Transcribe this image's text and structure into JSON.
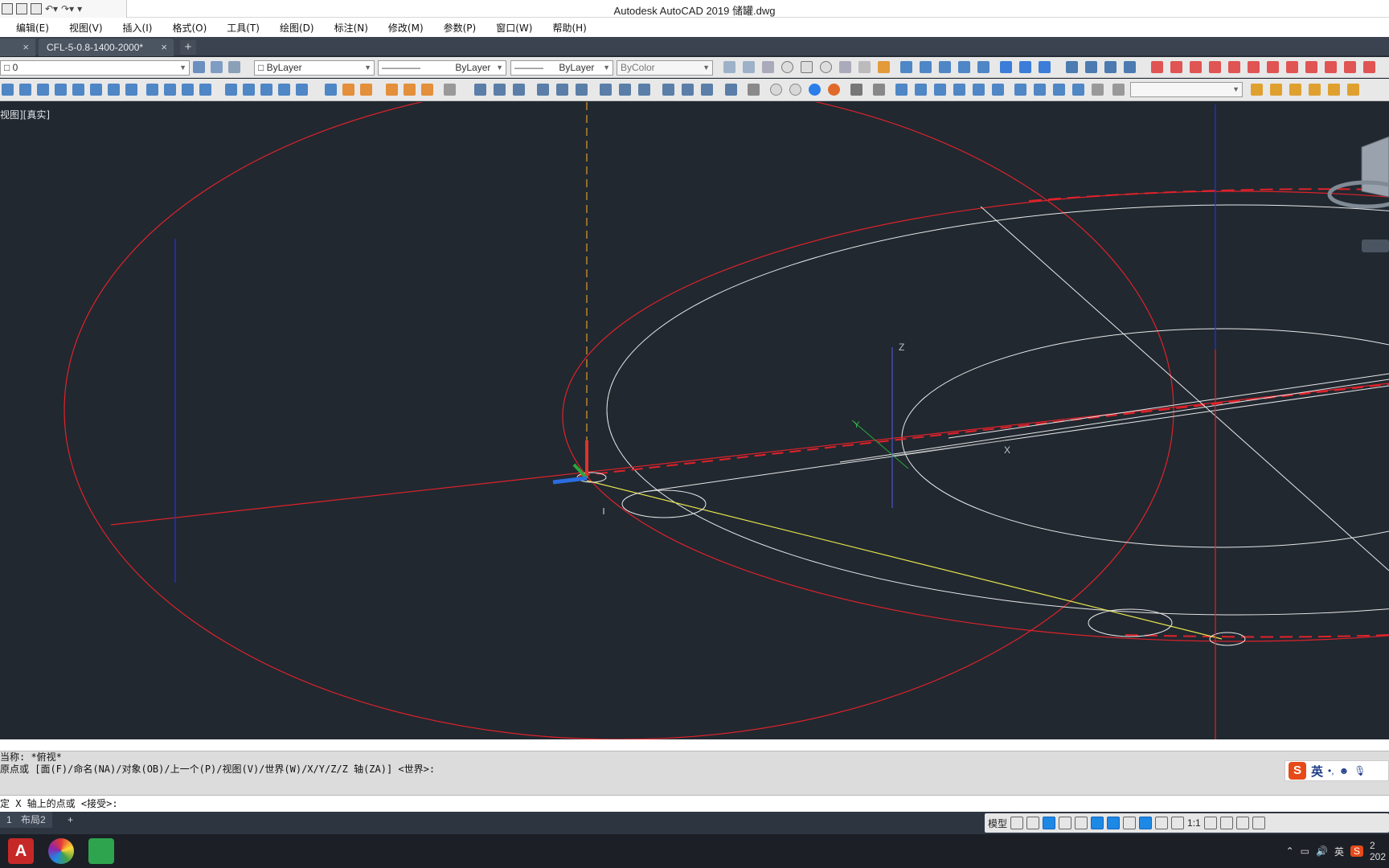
{
  "window": {
    "title": "Autodesk AutoCAD 2019    储罐.dwg"
  },
  "menu": [
    "编辑(E)",
    "视图(V)",
    "插入(I)",
    "格式(O)",
    "工具(T)",
    "绘图(D)",
    "标注(N)",
    "修改(M)",
    "参数(P)",
    "窗口(W)",
    "帮助(H)"
  ],
  "tabs": {
    "start_close": "×",
    "drawing": "CFL-5-0.8-1400-2000*",
    "drawing_close": "×",
    "new_tab": "+"
  },
  "properties": {
    "layer": "0",
    "color": "ByLayer",
    "linetype": "ByLayer",
    "lineweight": "ByLayer",
    "plotstyle": "ByColor"
  },
  "viewport": {
    "label": "视图][真实]",
    "axis_z": "Z",
    "axis_y": "Y",
    "axis_x": "X"
  },
  "command": {
    "history": [
      "当称: *俯视*",
      "原点或 [面(F)/命名(NA)/对象(OB)/上一个(P)/视图(V)/世界(W)/X/Y/Z/Z 轴(ZA)] <世界>:"
    ],
    "prompt": "定 X 轴上的点或 <接受>:"
  },
  "ime": {
    "logo": "S",
    "lang": "英"
  },
  "layout_tabs": {
    "l1": "1",
    "l2": "布局2",
    "add": "+"
  },
  "status": {
    "model": "模型",
    "scale": "1:1"
  },
  "taskbar": {
    "lang": "英",
    "time_partial": "2",
    "date_partial": "202"
  },
  "colors": {
    "canvas": "#212830",
    "red_line": "#e0222a",
    "white_line": "#e8e8e8",
    "blue_line": "#2233dd",
    "yellow_line": "#e6e44a"
  }
}
